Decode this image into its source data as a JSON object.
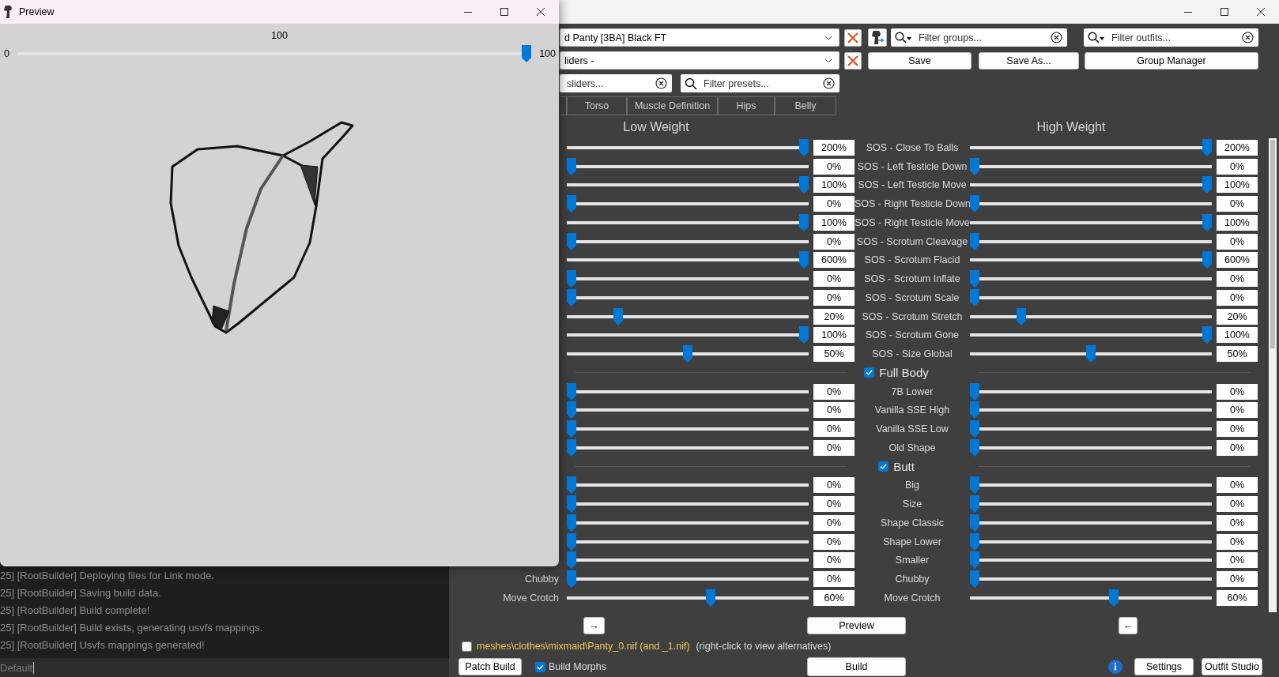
{
  "preview_window": {
    "title": "Preview",
    "slider": {
      "reading": "100",
      "min": "0",
      "max": "100",
      "level": 1
    }
  },
  "log_panel": {
    "lines": [
      "25] [RootBuilder] Deploying files for Link mode.",
      "25] [RootBuilder] Saving build data.",
      "25] [RootBuilder] Build complete!",
      "25] [RootBuilder] Build exists, generating usvfs mappings.",
      "25] [RootBuilder] Usvfs mappings generated!"
    ],
    "input": {
      "value": "Default"
    }
  },
  "main_window": {
    "outfit_dropdown": "d Panty [3BA] Black FT",
    "preset_dropdown": "liders -",
    "filter_groups": {
      "placeholder": "Filter groups..."
    },
    "filter_outfits": {
      "placeholder": "Filter outfits..."
    },
    "buttons": [
      "Save",
      "Save As...",
      "Group Manager"
    ],
    "filter_sliders": {
      "placeholder": "sliders..."
    },
    "filter_presets": {
      "placeholder": "Filter presets..."
    },
    "tabs": [
      "Torso",
      "Muscle Definition",
      "Hips",
      "Belly"
    ],
    "low_heading": "Low Weight",
    "high_heading": "High Weight",
    "rows": [
      {
        "kind": "slider",
        "label": "SOS - Close To Balls",
        "low": {
          "level": 1,
          "value": "200%"
        },
        "high": {
          "level": 1,
          "value": "200%"
        }
      },
      {
        "kind": "slider",
        "label": "SOS - Left Testicle Down",
        "low": {
          "level": 0,
          "value": "0%"
        },
        "high": {
          "level": 0,
          "value": "0%"
        }
      },
      {
        "kind": "slider",
        "label": "SOS - Left Testicle Move",
        "low": {
          "level": 1,
          "value": "100%"
        },
        "high": {
          "level": 1,
          "value": "100%"
        }
      },
      {
        "kind": "slider",
        "label": "SOS - Right Testicle Down",
        "low": {
          "level": 0,
          "value": "0%"
        },
        "high": {
          "level": 0,
          "value": "0%"
        }
      },
      {
        "kind": "slider",
        "label": "SOS - Right Testicle Move",
        "low": {
          "level": 1,
          "value": "100%"
        },
        "high": {
          "level": 1,
          "value": "100%"
        }
      },
      {
        "kind": "slider",
        "label": "SOS - Scrotum Cleavage",
        "low": {
          "level": 0,
          "value": "0%"
        },
        "high": {
          "level": 0,
          "value": "0%"
        }
      },
      {
        "kind": "slider",
        "label": "SOS - Scrotum Flacid",
        "low": {
          "level": 1,
          "value": "600%"
        },
        "high": {
          "level": 1,
          "value": "600%"
        }
      },
      {
        "kind": "slider",
        "label": "SOS - Scrotum Inflate",
        "low": {
          "level": 0,
          "value": "0%"
        },
        "high": {
          "level": 0,
          "value": "0%"
        }
      },
      {
        "kind": "slider",
        "label": "SOS - Scrotum Scale",
        "low": {
          "level": 0,
          "value": "0%"
        },
        "high": {
          "level": 0,
          "value": "0%"
        }
      },
      {
        "kind": "slider",
        "label": "SOS - Scrotum Stretch",
        "low": {
          "level": 0.2,
          "value": "20%"
        },
        "high": {
          "level": 0.2,
          "value": "20%"
        }
      },
      {
        "kind": "slider",
        "label": "SOS - Scrotum Gone",
        "low": {
          "level": 1,
          "value": "100%"
        },
        "high": {
          "level": 1,
          "value": "100%"
        }
      },
      {
        "kind": "slider",
        "label": "SOS - Size Global",
        "low": {
          "level": 0.5,
          "value": "50%"
        },
        "high": {
          "level": 0.5,
          "value": "50%"
        }
      },
      {
        "kind": "group",
        "label": "Full Body",
        "checked": true
      },
      {
        "kind": "slider",
        "label": "7B Lower",
        "low": {
          "level": 0,
          "value": "0%"
        },
        "high": {
          "level": 0,
          "value": "0%"
        }
      },
      {
        "kind": "slider",
        "label": "Vanilla SSE High",
        "low": {
          "level": 0,
          "value": "0%"
        },
        "high": {
          "level": 0,
          "value": "0%"
        }
      },
      {
        "kind": "slider",
        "label": "Vanilla SSE Low",
        "low": {
          "level": 0,
          "value": "0%"
        },
        "high": {
          "level": 0,
          "value": "0%"
        }
      },
      {
        "kind": "slider",
        "label": "Old Shape",
        "low": {
          "level": 0,
          "value": "0%"
        },
        "high": {
          "level": 0,
          "value": "0%"
        }
      },
      {
        "kind": "group",
        "label": "Butt",
        "checked": true
      },
      {
        "kind": "slider",
        "label": "Big",
        "low": {
          "level": 0,
          "value": "0%"
        },
        "high": {
          "level": 0,
          "value": "0%"
        }
      },
      {
        "kind": "slider",
        "label": "Size",
        "low": {
          "level": 0,
          "value": "0%"
        },
        "high": {
          "level": 0,
          "value": "0%"
        }
      },
      {
        "kind": "slider",
        "label": "Shape Classic",
        "low": {
          "level": 0,
          "value": "0%"
        },
        "high": {
          "level": 0,
          "value": "0%"
        }
      },
      {
        "kind": "slider",
        "label": "Shape Lower",
        "low": {
          "level": 0,
          "value": "0%"
        },
        "high": {
          "level": 0,
          "value": "0%"
        }
      },
      {
        "kind": "slider",
        "label": "Smaller",
        "low": {
          "level": 0,
          "value": "0%"
        },
        "high": {
          "level": 0,
          "value": "0%"
        }
      },
      {
        "kind": "slider",
        "side_label": "Chubby",
        "label": "Chubby",
        "low": {
          "level": 0,
          "value": "0%"
        },
        "high": {
          "level": 0,
          "value": "0%"
        }
      },
      {
        "kind": "slider",
        "side_label": "Move Crotch",
        "label": "Move Crotch",
        "low": {
          "level": 0.6,
          "value": "60%"
        },
        "high": {
          "level": 0.6,
          "value": "60%"
        }
      }
    ],
    "nav": {
      "copy_right": "→",
      "preview": "Preview",
      "copy_left": "←"
    },
    "output": {
      "checked": false,
      "path": "meshes\\clothes\\mixmaid\\Panty_0.nif (and _1.nif)",
      "hint": "(right-click to view alternatives)"
    },
    "bottom": {
      "patch_build": "Patch Build",
      "build_morphs": {
        "label": "Build Morphs",
        "checked": true
      },
      "build": "Build",
      "settings": "Settings",
      "outfit_studio": "Outfit Studio"
    }
  }
}
